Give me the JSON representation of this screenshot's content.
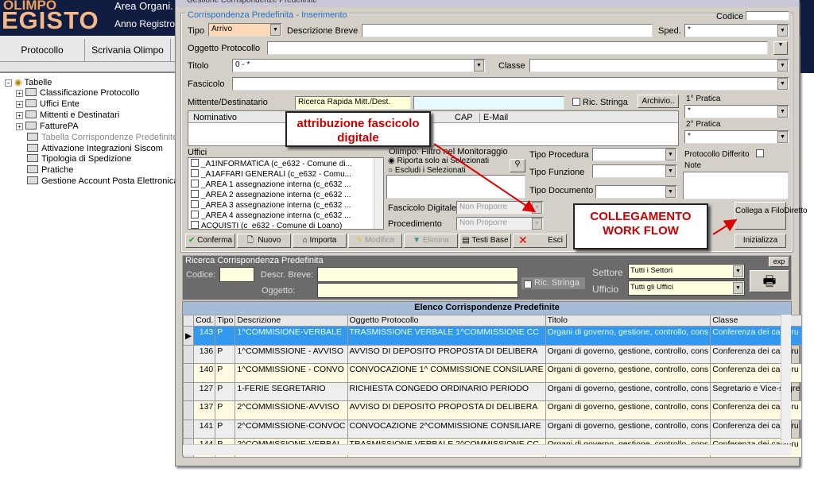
{
  "app": {
    "logo_top": "OLIMPO",
    "logo_bottom": "EGISTO",
    "area": "Area Organi.",
    "anno": "Anno Registro"
  },
  "app_tabs": [
    "Protocollo",
    "Scrivania Olimpo"
  ],
  "tree": {
    "root": "Tabelle",
    "items": [
      "Classificazione Protocollo",
      "Uffici Ente",
      "Mittenti e Destinatari",
      "FatturePA",
      "Tabella Corrispondenze Predefinite",
      "Attivazione Integrazioni Siscom",
      "Tipologia di Spedizione",
      "Pratiche",
      "Gestione Account Posta Elettronica In"
    ]
  },
  "dialog": {
    "title": "Gestione Corrispondenze Predefinite",
    "section": "Corrispondenza Predefinita - Inserimento",
    "codice_label": "Codice",
    "tipo_label": "Tipo",
    "tipo_value": "Arrivo",
    "descr_breve_label": "Descrizione Breve",
    "sped_label": "Sped.",
    "sped_value": "*",
    "oggetto_label": "Oggetto Protocollo",
    "titolo_label": "Titolo",
    "titolo_value": "0 - *",
    "classe_label": "Classe",
    "fascicolo_label": "Fascicolo",
    "mittente_label": "Mittente/Destinatario",
    "ricerca_rapida": "Ricerca Rapida Mitt./Dest.",
    "ric_stringa": "Ric. Stringa",
    "archivio": "Archivio..",
    "pratica1_label": "1° Pratica",
    "pratica1_value": "*",
    "pratica2_label": "2° Pratica",
    "pratica2_value": "*",
    "mitt_columns": [
      "Nominativo",
      "CAP",
      "E-Mail"
    ],
    "uffici_label": "Uffici",
    "uffici": [
      "_A1INFORMATICA (c_e632 - Comune di...",
      "_A1AFFARI GENERALI (c_e632 - Comu...",
      "_AREA 1 assegnazione interna (c_e632 ...",
      "_AREA 2 assegnazione interna (c_e632 ...",
      "_AREA 3 assegnazione interna (c_e632 ...",
      "_AREA 4 assegnazione interna (c_e632 ...",
      "ACQUISTI (c_e632 - Comune di Loano)"
    ],
    "monitoraggio_label": "Olimpo: Filtro nel Monitoraggio",
    "radio1": "Riporta solo ai Selezionati",
    "radio2": "Escludi i Selezionati",
    "tipo_procedura": "Tipo Procedura",
    "tipo_funzione": "Tipo Funzione",
    "tipo_documento": "Tipo Documento",
    "protocollo_differito": "Protocollo Differito",
    "note": "Note",
    "fascicolo_digitale_label": "Fascicolo Digitale",
    "fascicolo_digitale_value": "Non Proporre",
    "procedimento_label": "Procedimento",
    "procedimento_value": "Non Proporre",
    "buttons": {
      "conferma": "Conferma",
      "nuovo": "Nuovo",
      "importa": "Importa",
      "modifica": "Modifica",
      "elimina": "Elimina",
      "testi_base": "Testi Base",
      "esci": "Esci",
      "collega": "Collega a FiloDiretto",
      "inizializza": "Inizializza"
    },
    "callout1": "attribuzione fascicolo digitale",
    "callout2": "COLLEGAMENTO WORK FLOW"
  },
  "search": {
    "title": "Ricerca Corrispondenza Predefinita",
    "exp": "exp",
    "codice": "Codice:",
    "descr": "Descr. Breve:",
    "oggetto": "Oggetto:",
    "ric_stringa": "Ric. Stringa",
    "settore_label": "Settore",
    "settore_value": "Tutti i Settori",
    "ufficio_label": "Ufficio",
    "ufficio_value": "Tutti gli Uffici"
  },
  "list": {
    "title": "Elenco Corrispondenze Predefinite",
    "columns": [
      "Cod.",
      "Tipo",
      "Descrizione",
      "Oggetto Protocollo",
      "Titolo",
      "Classe"
    ],
    "rows": [
      [
        "143",
        "P",
        "1^COMMISIONE-VERBALE",
        "TRASMISSIONE VERBALE 1^COMMISSIONE CC",
        "Organi di governo, gestione, controllo, cons",
        "Conferenza dei capigru"
      ],
      [
        "136",
        "P",
        "1^COMMISSIONE - AVVISO",
        "AVVISO DI DEPOSITO PROPOSTA DI DELIBERA",
        "Organi di governo, gestione, controllo, cons",
        "Conferenza dei capigru"
      ],
      [
        "140",
        "P",
        "1^COMMISSIONE - CONVO",
        "CONVOCAZIONE 1^ COMMISSIONE CONSILIARE",
        "Organi di governo, gestione, controllo, cons",
        "Conferenza dei capigru"
      ],
      [
        "127",
        "P",
        "1-FERIE SEGRETARIO",
        "RICHIESTA CONGEDO ORDINARIO PERIODO",
        "Organi di governo, gestione, controllo, cons",
        "Segretario e Vice-segre"
      ],
      [
        "137",
        "P",
        "2^COMMISSIONE-AVVISO",
        "AVVISO DI DEPOSITO PROPOSTA DI DELIBERA",
        "Organi di governo, gestione, controllo, cons",
        "Conferenza dei capigru"
      ],
      [
        "141",
        "P",
        "2^COMMISSIONE-CONVOC",
        "CONVOCAZIONE 2^COMMISSIONE CONSILIARE",
        "Organi di governo, gestione, controllo, cons",
        "Conferenza dei capigru"
      ],
      [
        "144",
        "P",
        "2^COMMISSIONE-VERBAL",
        "TRASMISSIONE VERBALE 2^COMMISSIONE CC",
        "Organi di governo, gestione, controllo, cons",
        "Conferenza dei capigru"
      ]
    ]
  }
}
